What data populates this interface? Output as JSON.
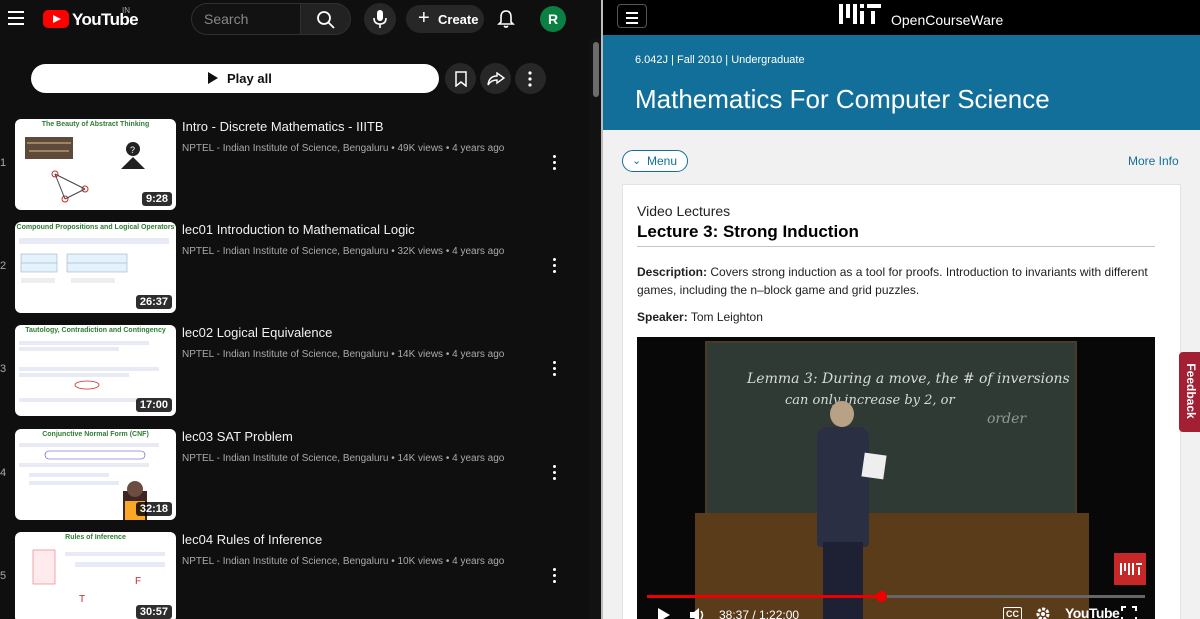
{
  "youtube": {
    "logo_text": "YouTube",
    "region": "IN",
    "search_placeholder": "Search",
    "create_label": "Create",
    "avatar_initial": "R",
    "play_all_label": "Play all",
    "videos": [
      {
        "index": "1",
        "title": "Intro - Discrete Mathematics - IIITB",
        "meta": "NPTEL - Indian Institute of Science, Bengaluru • 49K views • 4 years ago",
        "duration": "9:28",
        "thumb_title": "The Beauty of Abstract Thinking"
      },
      {
        "index": "2",
        "title": "lec01 Introduction to Mathematical Logic",
        "meta": "NPTEL - Indian Institute of Science, Bengaluru • 32K views • 4 years ago",
        "duration": "26:37",
        "thumb_title": "Compound Propositions and Logical Operators"
      },
      {
        "index": "3",
        "title": "lec02 Logical Equivalence",
        "meta": "NPTEL - Indian Institute of Science, Bengaluru • 14K views • 4 years ago",
        "duration": "17:00",
        "thumb_title": "Tautology, Contradiction and Contingency"
      },
      {
        "index": "4",
        "title": "lec03 SAT Problem",
        "meta": "NPTEL - Indian Institute of Science, Bengaluru • 14K views • 4 years ago",
        "duration": "32:18",
        "thumb_title": "Conjunctive Normal Form (CNF)"
      },
      {
        "index": "5",
        "title": "lec04 Rules of Inference",
        "meta": "NPTEL - Indian Institute of Science, Bengaluru • 10K views • 4 years ago",
        "duration": "30:57",
        "thumb_title": "Rules of Inference"
      }
    ]
  },
  "ocw": {
    "brand": "OpenCourseWare",
    "course_meta": "6.042J | Fall 2010 | Undergraduate",
    "course_title": "Mathematics For Computer Science",
    "menu_label": "Menu",
    "more_info_label": "More Info",
    "section_label": "Video Lectures",
    "lecture_title": "Lecture 3: Strong Induction",
    "description_label": "Description:",
    "description_text": "Covers strong induction as a tool for proofs. Introduction to invariants with different games, including the n–block game and grid puzzles.",
    "speaker_label": "Speaker:",
    "speaker_name": "Tom Leighton",
    "player": {
      "time": "38:37 / 1:22:00",
      "progress": 0.47,
      "board_line1": "Lemma 3: During a move, the # of inversions",
      "board_line2": "can only increase by 2, or",
      "board_word": "order",
      "cc_label": "CC",
      "youtube_label": "YouTube"
    },
    "feedback_label": "Feedback"
  }
}
